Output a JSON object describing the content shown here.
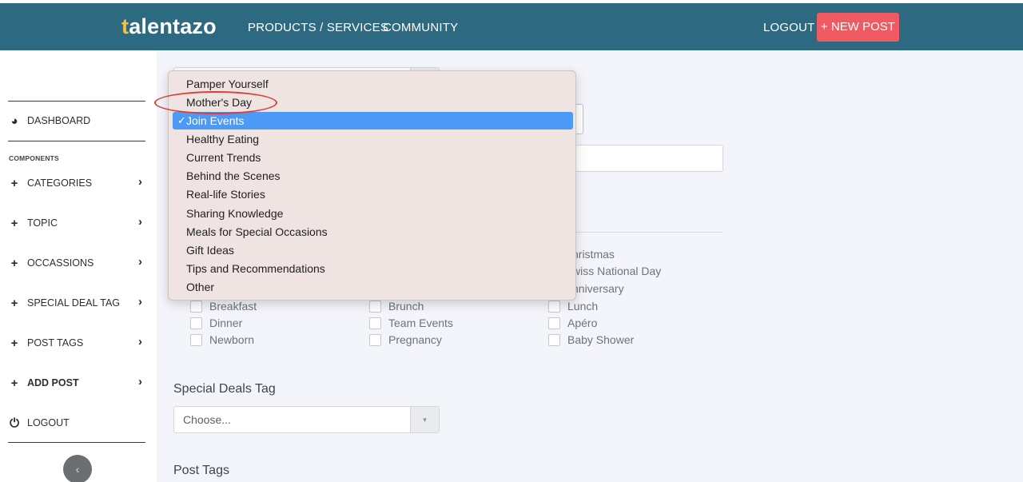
{
  "header": {
    "logo_first": "t",
    "logo_rest": "alentazo",
    "nav": [
      "PRODUCTS / SERVICES",
      "COMMUNITY"
    ],
    "logout": "LOGOUT",
    "new_post": "+ NEW POST"
  },
  "sidebar": {
    "dashboard": "DASHBOARD",
    "components_label": "COMPONENTS",
    "items": [
      "CATEGORIES",
      "TOPIC",
      "OCCASSIONS",
      "SPECIAL DEAL TAG",
      "POST TAGS",
      "ADD POST"
    ],
    "logout": "LOGOUT",
    "collapse_icon": "chevron-left-icon"
  },
  "topic_menu": {
    "options": [
      "Pamper Yourself",
      "Mother's Day",
      "Join Events",
      "Healthy Eating",
      "Current Trends",
      "Behind the Scenes",
      "Real-life Stories",
      "Sharing Knowledge",
      "Meals for Special Occasions",
      "Gift Ideas",
      "Tips and Recommendations",
      "Other"
    ],
    "selected": "Join Events",
    "check_mark": "✓"
  },
  "occasions": {
    "partial_labels": [
      "hristmas",
      "wiss National Day",
      "nniversary"
    ],
    "rows": [
      [
        "Breakfast",
        "Brunch",
        "Lunch"
      ],
      [
        "Dinner",
        "Team Events",
        "Apéro"
      ],
      [
        "Newborn",
        "Pregnancy",
        "Baby Shower"
      ]
    ]
  },
  "special_deals": {
    "title": "Special Deals Tag",
    "placeholder": "Choose...",
    "caret": "▾"
  },
  "post_tags": {
    "title": "Post Tags"
  },
  "colors": {
    "header_bg": "#2d6a82",
    "accent_button": "#ef5a63",
    "logo_accent": "#f5c341",
    "selection": "#4c9af6",
    "annotation_ring": "#d9403a"
  }
}
